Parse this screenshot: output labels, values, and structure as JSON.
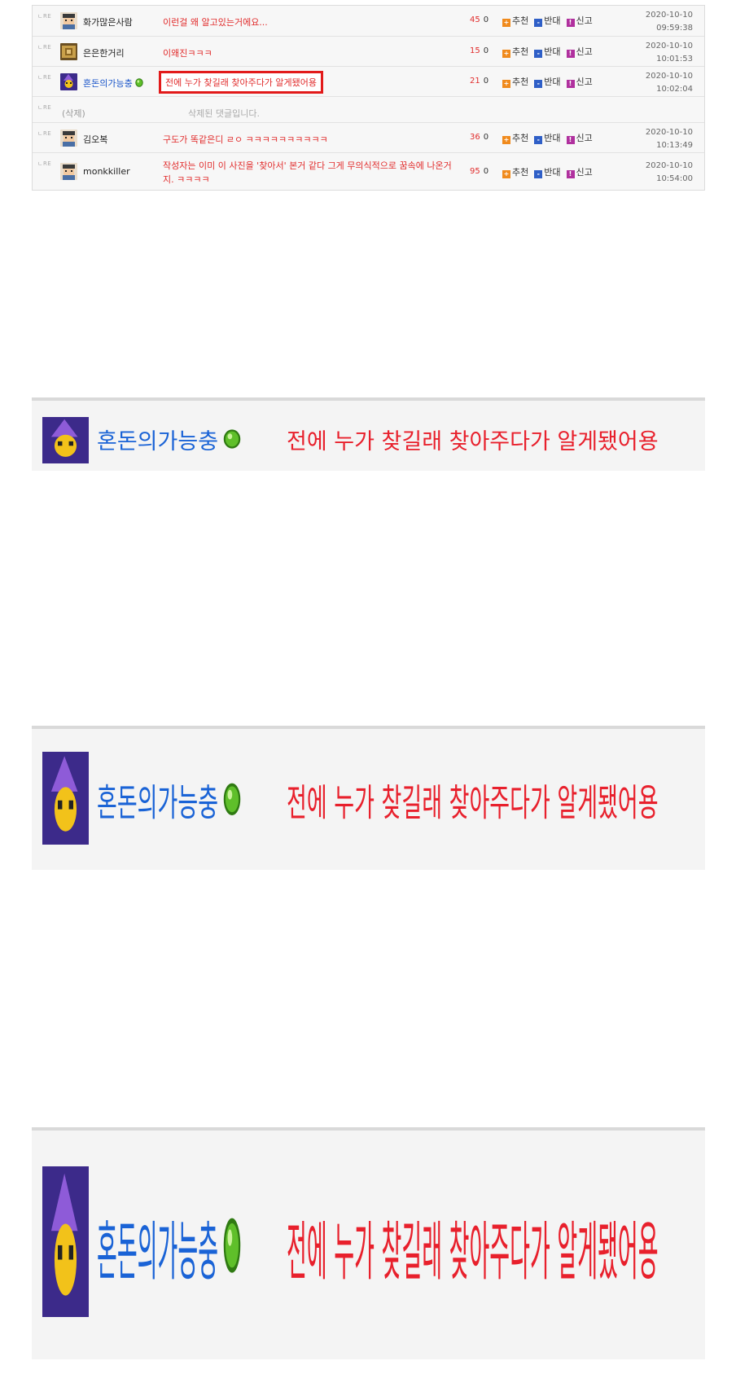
{
  "comments": [
    {
      "re": "ㄴRE",
      "nick": "화가많은사람",
      "message": "이런걸 왜 알고있는거에요...",
      "up": "45",
      "down": "0",
      "date": "2020-10-10",
      "time": "09:59:38",
      "avatar": "pixel-man"
    },
    {
      "re": "ㄴRE",
      "nick": "은은한거리",
      "message": "이왜진ㅋㅋㅋ",
      "up": "15",
      "down": "0",
      "date": "2020-10-10",
      "time": "10:01:53",
      "avatar": "photo"
    },
    {
      "re": "ㄴRE",
      "nick": "혼돈의가능충",
      "message": "전에 누가 찾길래 찾아주다가 알게됐어용",
      "up": "21",
      "down": "0",
      "date": "2020-10-10",
      "time": "10:02:04",
      "avatar": "wizard"
    },
    {
      "re": "ㄴRE",
      "nick": "(삭제)",
      "message": "삭제된 댓글입니다."
    },
    {
      "re": "ㄴRE",
      "nick": "김오복",
      "message": "구도가 똑같은디 ㄹㅇ ㅋㅋㅋㅋㅋㅋㅋㅋㅋㅋ",
      "up": "36",
      "down": "0",
      "date": "2020-10-10",
      "time": "10:13:49",
      "avatar": "pixel-man"
    },
    {
      "re": "ㄴRE",
      "nick": "monkkiller",
      "message": "작성자는 이미 이 사진을 '찾아서' 본거 같다 그게 무의식적으로 꿈속에 나온거지. ㅋㅋㅋㅋ",
      "up": "95",
      "down": "0",
      "date": "2020-10-10",
      "time": "10:54:00",
      "avatar": "pixel-man"
    }
  ],
  "actions": {
    "recommend": "추천",
    "oppose": "반대",
    "report": "신고"
  },
  "zoom": {
    "nick": "혼돈의가능충",
    "message": "전에 누가 찾길래 찾아주다가 알게됐어용"
  },
  "colors": {
    "message_red": "#e12c2c",
    "nick_blue": "#1a55c9",
    "highlight_border": "#e21a1a",
    "recommend": "#f08a1c",
    "oppose": "#2f5fc7",
    "report": "#b0309e"
  },
  "icons": {
    "recommend": "plus-square-icon",
    "oppose": "minus-square-icon",
    "report": "report-icon",
    "level": "green-gem-icon"
  }
}
